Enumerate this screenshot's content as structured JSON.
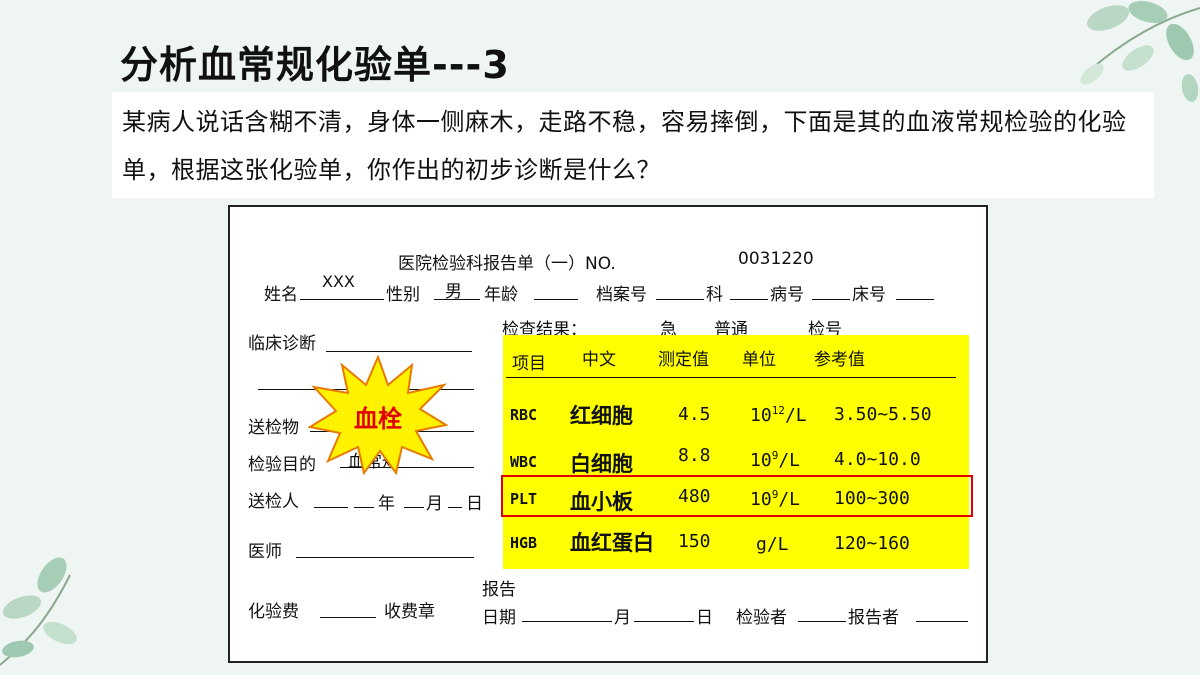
{
  "title": "分析血常规化验单---3",
  "question": "某病人说话含糊不清，身体一侧麻木，走路不稳，容易摔倒，下面是其的血液常规检验的化验单，根据这张化验单，你作出的初步诊断是什么？",
  "report": {
    "heading": "医院检验科报告单（一）NO.",
    "number": "0031220",
    "name_label": "姓名",
    "name_value": "XXX",
    "sex_label": "性别",
    "sex_value": "男",
    "age_label": "年龄",
    "file_label": "档案号",
    "dept_label": "科",
    "ward_label": "病号",
    "bed_label": "床号",
    "clinical_dx_label": "临床诊断",
    "specimen_label": "送检物",
    "purpose_label": "检验目的",
    "purpose_value": "血常规",
    "sender_label": "送检人",
    "year": "年",
    "month": "月",
    "day": "日",
    "doctor_label": "医师",
    "fee_label": "化验费",
    "stamp_label": "收费章",
    "report_label": "报告",
    "date_label": "日期",
    "inspector_label": "检验者",
    "reporter_label": "报告者",
    "results_label": "检查结果：",
    "urgent": "急",
    "normal": "普通",
    "check_no": "检号",
    "columns": [
      "项目",
      "中文",
      "测定值",
      "单位",
      "参考值"
    ],
    "rows": [
      {
        "code": "RBC",
        "cn": "红细胞",
        "value": "4.5",
        "unit_base": "10",
        "unit_exp": "12",
        "unit_tail": "/L",
        "ref": "3.50~5.50"
      },
      {
        "code": "WBC",
        "cn": "白细胞",
        "value": "8.8",
        "unit_base": "10",
        "unit_exp": "9",
        "unit_tail": "/L",
        "ref": "4.0~10.0"
      },
      {
        "code": "PLT",
        "cn": "血小板",
        "value": "480",
        "unit_base": "10",
        "unit_exp": "9",
        "unit_tail": "/L",
        "ref": "100~300"
      },
      {
        "code": "HGB",
        "cn": "血红蛋白",
        "value": "150",
        "unit_base": "g/L",
        "unit_exp": "",
        "unit_tail": "",
        "ref": "120~160"
      }
    ]
  },
  "burst_label": "血栓",
  "colors": {
    "highlight": "#ffff00",
    "alert": "#e00000",
    "burst_fill": "#fff200",
    "background": "#eef5f2"
  }
}
